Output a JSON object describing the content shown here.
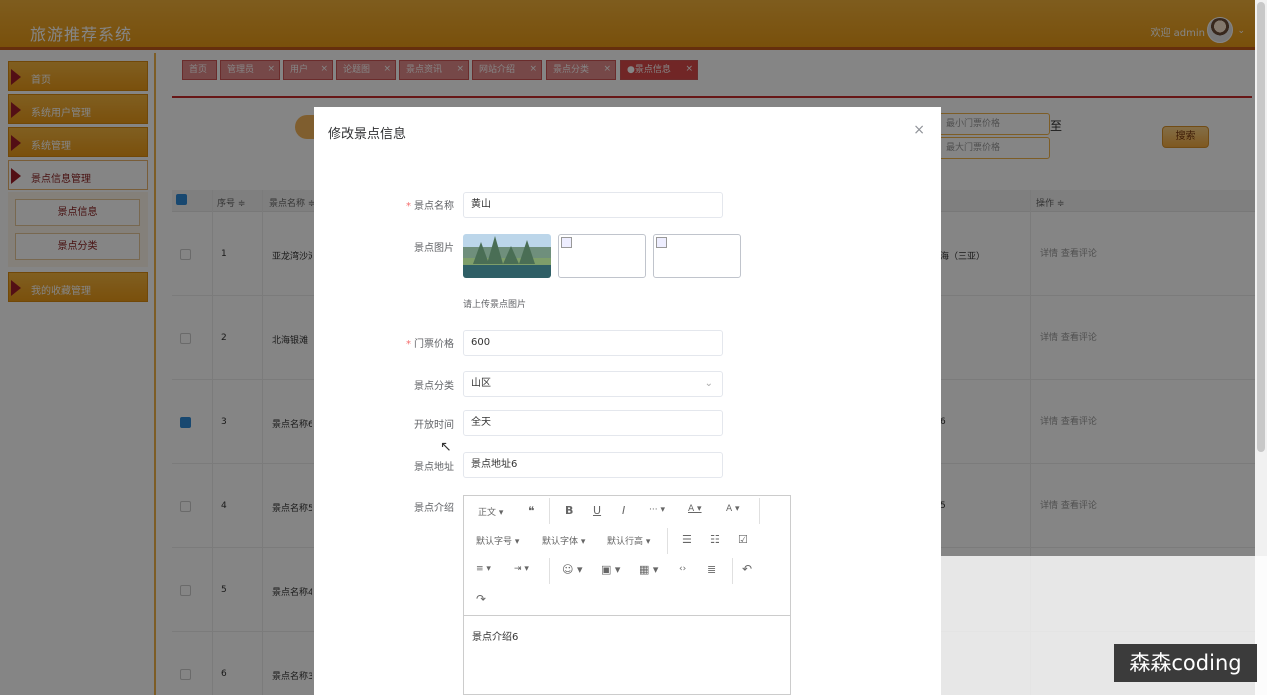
{
  "header": {
    "app_title": "旅游推荐系统",
    "welcome": "欢迎 admin"
  },
  "sidebar": {
    "items": [
      {
        "label": "首页"
      },
      {
        "label": "系统用户管理"
      },
      {
        "label": "系统管理"
      },
      {
        "label": "景点信息管理"
      },
      {
        "label": "我的收藏管理"
      }
    ],
    "subitems": [
      {
        "label": "景点信息"
      },
      {
        "label": "景点分类"
      }
    ]
  },
  "tabs": [
    {
      "label": "首页"
    },
    {
      "label": "管理员"
    },
    {
      "label": "用户"
    },
    {
      "label": "论题图"
    },
    {
      "label": "景点资讯"
    },
    {
      "label": "网站介绍"
    },
    {
      "label": "景点分类"
    },
    {
      "label": "●景点信息"
    }
  ],
  "search": {
    "min_price_placeholder": "最小门票价格",
    "max_price_placeholder": "最大门票价格",
    "range_sep": "至",
    "button": "搜索"
  },
  "table": {
    "headers": {
      "index": "序号 ≑",
      "name": "景点名称 ≑",
      "actions": "操作 ≑"
    },
    "rows": [
      {
        "index": "1",
        "name": "亚龙湾沙滩",
        "category": "海（三亚）",
        "actions": "详情 查看评论"
      },
      {
        "index": "2",
        "name": "北海银滩",
        "category": "",
        "actions": "详情 查看评论"
      },
      {
        "index": "3",
        "name": "景点名称6",
        "category": "6",
        "actions": "详情 查看评论"
      },
      {
        "index": "4",
        "name": "景点名称5",
        "category": "5",
        "actions": "详情 查看评论"
      },
      {
        "index": "5",
        "name": "景点名称4",
        "category": "",
        "actions": ""
      },
      {
        "index": "6",
        "name": "景点名称3",
        "category": "",
        "actions": ""
      }
    ]
  },
  "modal": {
    "title": "修改景点信息",
    "close": "×",
    "fields": {
      "name": {
        "label": "景点名称",
        "value": "黄山"
      },
      "images": {
        "label": "景点图片",
        "hint": "请上传景点图片"
      },
      "price": {
        "label": "门票价格",
        "value": "600"
      },
      "category": {
        "label": "景点分类",
        "value": "山区"
      },
      "open_time": {
        "label": "开放时间",
        "value": "全天"
      },
      "address": {
        "label": "景点地址",
        "value": "景点地址6"
      },
      "intro": {
        "label": "景点介绍",
        "value": "景点介绍6"
      }
    },
    "editor_toolbar": {
      "paragraph": "正文 ▾",
      "quote": "❝",
      "bold": "B",
      "underline": "U",
      "italic": "I",
      "more": "··· ▾",
      "font_color": "A ▾",
      "bg_color": "A ▾",
      "font_size": "默认字号 ▾",
      "font_family": "默认字体 ▾",
      "line_height": "默认行高 ▾",
      "bullet_list": "☰",
      "numbered_list": "☷",
      "todo": "☑",
      "align": "≡ ▾",
      "indent": "⇥ ▾",
      "emoji": "☺ ▾",
      "image": "▣ ▾",
      "table": "▦ ▾",
      "code": "‹›",
      "divider": "≣",
      "undo": "↶",
      "redo": "↷"
    }
  },
  "watermark": "森森coding"
}
